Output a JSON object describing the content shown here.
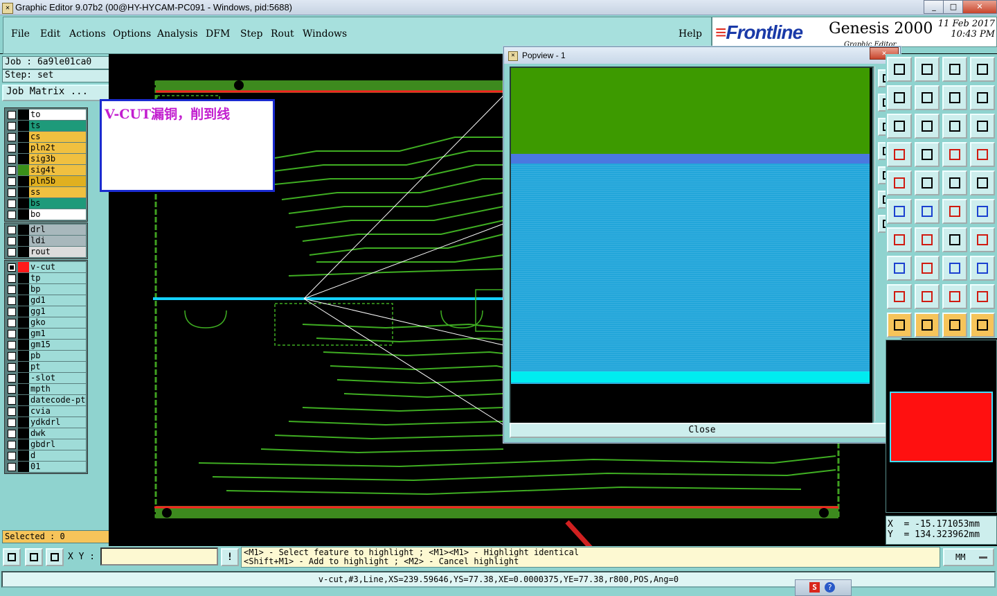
{
  "window": {
    "title": "Graphic Editor 9.07b2 (00@HY-HYCAM-PC091 - Windows, pid:5688)",
    "min": "_",
    "max": "□",
    "close": "✕"
  },
  "menu": [
    "File",
    "Edit",
    "Actions",
    "Options",
    "Analysis",
    "DFM",
    "Step",
    "Rout",
    "Windows"
  ],
  "help": "Help",
  "branding": {
    "frontline_prefix": "≡",
    "frontline": "Frontline",
    "genesis": "Genesis 2000",
    "subtitle": "Graphic Editor",
    "date": "11 Feb 2017",
    "time": "10:43 PM"
  },
  "job": {
    "job_label": "Job : 6a9le01ca0",
    "step_label": "Step: set",
    "matrix_button": "Job Matrix ..."
  },
  "layers_top": [
    {
      "name": "to",
      "color": "#ffffff",
      "active_color": "#000000"
    },
    {
      "name": "ts",
      "color": "#1e9a7a",
      "active_color": "#000000"
    },
    {
      "name": "cs",
      "color": "#f0c040",
      "active_color": "#000000"
    },
    {
      "name": "pln2t",
      "color": "#f0c040",
      "active_color": "#000000"
    },
    {
      "name": "sig3b",
      "color": "#f0c040",
      "active_color": "#000000"
    },
    {
      "name": "sig4t",
      "color": "#f0c040",
      "active_color": "#3a8f1a"
    },
    {
      "name": "pln5b",
      "color": "#e0b020",
      "active_color": "#000000"
    },
    {
      "name": "ss",
      "color": "#f0c040",
      "active_color": "#000000"
    },
    {
      "name": "bs",
      "color": "#1e9a7a",
      "active_color": "#000000"
    },
    {
      "name": "bo",
      "color": "#ffffff",
      "active_color": "#000000"
    }
  ],
  "layers_drill": [
    {
      "name": "drl",
      "color": "#a8b8bc"
    },
    {
      "name": "ldi",
      "color": "#a8b8bc"
    },
    {
      "name": "rout",
      "color": "#dcdcdc"
    }
  ],
  "layers_misc": [
    {
      "name": "v-cut",
      "color": "#9fdcd8",
      "active_color": "#ff1a1a",
      "on": true
    },
    {
      "name": "tp",
      "color": "#9fdcd8"
    },
    {
      "name": "bp",
      "color": "#9fdcd8"
    },
    {
      "name": "gd1",
      "color": "#9fdcd8"
    },
    {
      "name": "gg1",
      "color": "#9fdcd8"
    },
    {
      "name": "gko",
      "color": "#9fdcd8"
    },
    {
      "name": "gm1",
      "color": "#9fdcd8"
    },
    {
      "name": "gm15",
      "color": "#9fdcd8"
    },
    {
      "name": "pb",
      "color": "#9fdcd8"
    },
    {
      "name": "pt",
      "color": "#9fdcd8"
    },
    {
      "name": "-slot",
      "color": "#9fdcd8"
    },
    {
      "name": "mpth",
      "color": "#9fdcd8"
    },
    {
      "name": "datecode-pt",
      "color": "#9fdcd8"
    },
    {
      "name": "cvia",
      "color": "#9fdcd8"
    },
    {
      "name": "ydkdrl",
      "color": "#9fdcd8"
    },
    {
      "name": "dwk",
      "color": "#9fdcd8"
    },
    {
      "name": "gbdrl",
      "color": "#9fdcd8"
    },
    {
      "name": "d",
      "color": "#9fdcd8"
    },
    {
      "name": "01",
      "color": "#9fdcd8"
    }
  ],
  "selected": "Selected : 0",
  "annotation": "V-CUT漏铜，削到线",
  "popview": {
    "title": "Popview - 1",
    "close_x": "✕",
    "close_button": "Close"
  },
  "coords": {
    "x": "X  = -15.171053mm",
    "y": "Y  = 134.323962mm"
  },
  "bottom": {
    "xy_label": "X Y :",
    "xy_value": "",
    "bang": "!",
    "hint_line1": "<M1> - Select feature to highlight ; <M1><M1> - Highlight identical",
    "hint_line2": "<Shift+M1> - Add to highlight ; <M2> - Cancel highlight",
    "units": "MM",
    "status": "v-cut,#3,Line,XS=239.59646,YS=77.38,XE=0.0000375,YE=77.38,r800,POS,Ang=0"
  },
  "tray": {
    "s": "S",
    "q": "?"
  }
}
